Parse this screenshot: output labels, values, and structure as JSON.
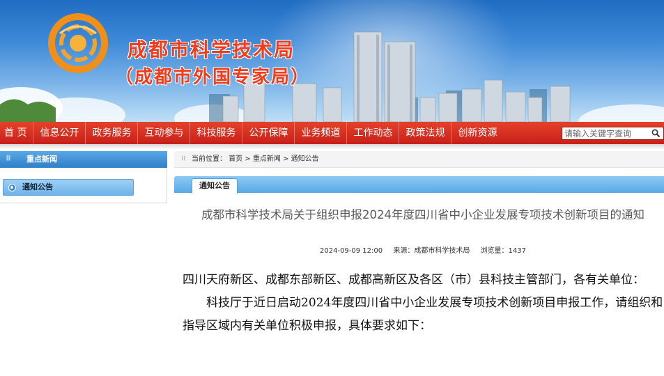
{
  "header": {
    "title_line1": "成都市科学技术局",
    "title_line2": "（成都市外国专家局）"
  },
  "nav": {
    "items": [
      "首 页",
      "信息公开",
      "政务服务",
      "互动参与",
      "科技服务",
      "公开保障",
      "业务频道",
      "工作动态",
      "政策法规",
      "创新资源"
    ],
    "search_placeholder": "请输入关键字查询"
  },
  "sidebar": {
    "heading": "重点新闻",
    "items": [
      "通知公告"
    ]
  },
  "breadcrumb": "当前位置： 首页 > 重点新闻 > 通知公告",
  "tab": "通知公告",
  "article": {
    "title": "成都市科学技术局关于组织申报2024年度四川省中小企业发展专项技术创新项目的通知",
    "date": "2024-09-09 12:00",
    "source": "来源：成都市科学技术局",
    "views": "浏览量：1437",
    "paragraph1": "四川天府新区、成都东部新区、成都高新区及各区（市）县科技主管部门，各有关单位：",
    "paragraph2": "科技厅于近日启动2024年度四川省中小企业发展专项技术创新项目申报工作，请组织和指导区域内有关单位积极申报，具体要求如下："
  },
  "colors": {
    "nav_red": "#d42f1f",
    "accent_blue": "#3b8ad6",
    "title_red": "#ef3c1c"
  }
}
